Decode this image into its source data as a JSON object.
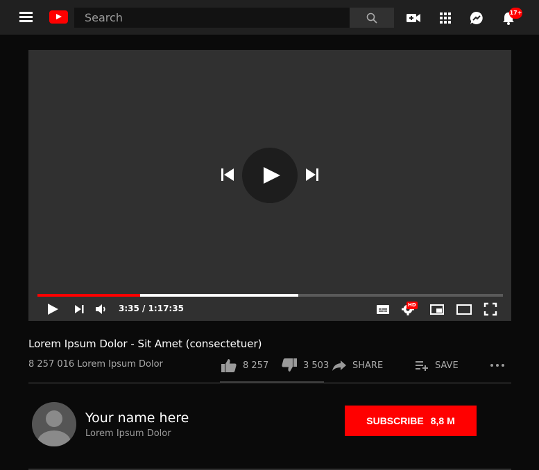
{
  "header": {
    "search": {
      "placeholder": "Search"
    },
    "notifications_badge": "17+",
    "icons": [
      "menu-icon",
      "youtube-logo",
      "search-icon",
      "create-video-icon",
      "apps-icon",
      "messages-icon",
      "bell-icon"
    ],
    "brand_color": "#ff0000"
  },
  "player": {
    "current_time": "3:35",
    "duration": "1:17:35",
    "time_display": "3:35 / 1:17:35",
    "played_fraction": 0.22,
    "buffered_fraction": 0.56,
    "quality_badge": "HD",
    "controls": [
      "play-icon",
      "next-icon",
      "volume-icon",
      "subtitles-icon",
      "settings-icon",
      "miniplayer-icon",
      "theater-icon",
      "fullscreen-icon"
    ]
  },
  "video": {
    "title": "Lorem Ipsum Dolor - Sit Amet (consectetuer)",
    "views": "8 257 016 Lorem Ipsum Dolor",
    "likes": "8 257",
    "dislikes": "3 503",
    "share_label": "SHARE",
    "save_label": "SAVE"
  },
  "channel": {
    "name": "Your name here",
    "subtitle": "Lorem Ipsum Dolor",
    "subscribe_label": "SUBSCRIBE",
    "subscriber_count": "8,8 M"
  }
}
